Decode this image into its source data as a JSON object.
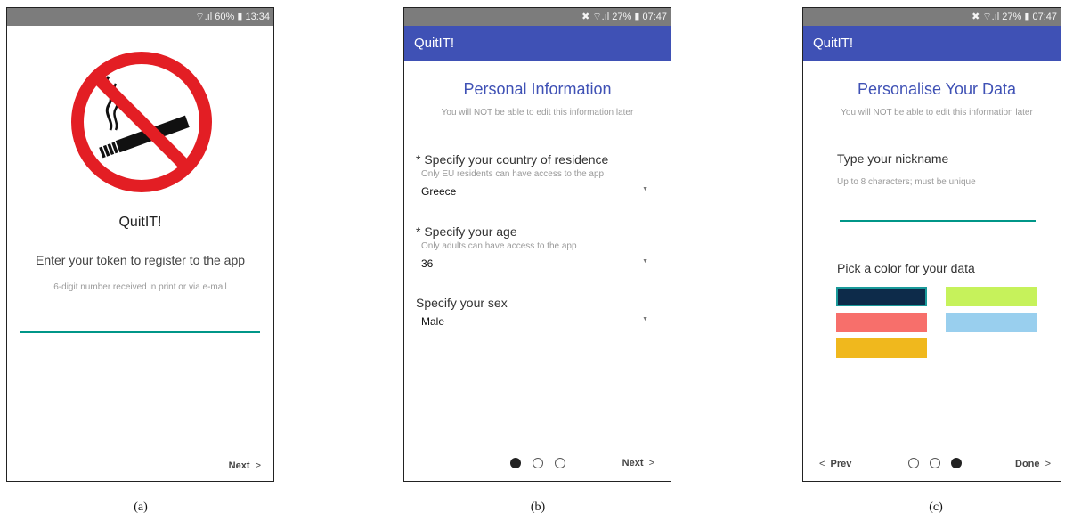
{
  "screen_a": {
    "status": "⌔.ıl 60% ▮ 13:34",
    "app_name": "QuitIT!",
    "prompt": "Enter your token to register to the app",
    "hint": "6-digit number received in print or via e-mail",
    "next_label": "Next",
    "colors": {
      "sign_red": "#e31e24",
      "cigarette": "#111111"
    }
  },
  "screen_b": {
    "status": "✖ ⌔.ıl 27% ▮ 07:47",
    "appbar_title": "QuitIT!",
    "title": "Personal Information",
    "subtitle": "You will NOT be able to edit this information later",
    "country": {
      "label": "* Specify your country of residence",
      "hint": "Only EU residents can have access to the app",
      "value": "Greece"
    },
    "age": {
      "label": "* Specify your age",
      "hint": "Only adults can have access to the app",
      "value": "36"
    },
    "sex": {
      "label": "Specify your sex",
      "value": "Male"
    },
    "next_label": "Next",
    "current_page": 1,
    "total_pages": 3
  },
  "screen_c": {
    "status": "✖ ⌔.ıl 27% ▮ 07:47",
    "appbar_title": "QuitIT!",
    "title": "Personalise Your Data",
    "subtitle": "You will NOT be able to edit this information later",
    "nickname_label": "Type your nickname",
    "nickname_hint": "Up to 8 characters; must be unique",
    "color_label": "Pick a color for your data",
    "swatches": [
      "#0d2b4a",
      "#c6f25b",
      "#f76f6b",
      "#99cfee",
      "#f0b81d"
    ],
    "selected_swatch": 0,
    "prev_label": "Prev",
    "done_label": "Done",
    "current_page": 3,
    "total_pages": 3
  },
  "captions": [
    "(a)",
    "(b)",
    "(c)"
  ],
  "accent": "#3f51b5",
  "underline": "#009688"
}
